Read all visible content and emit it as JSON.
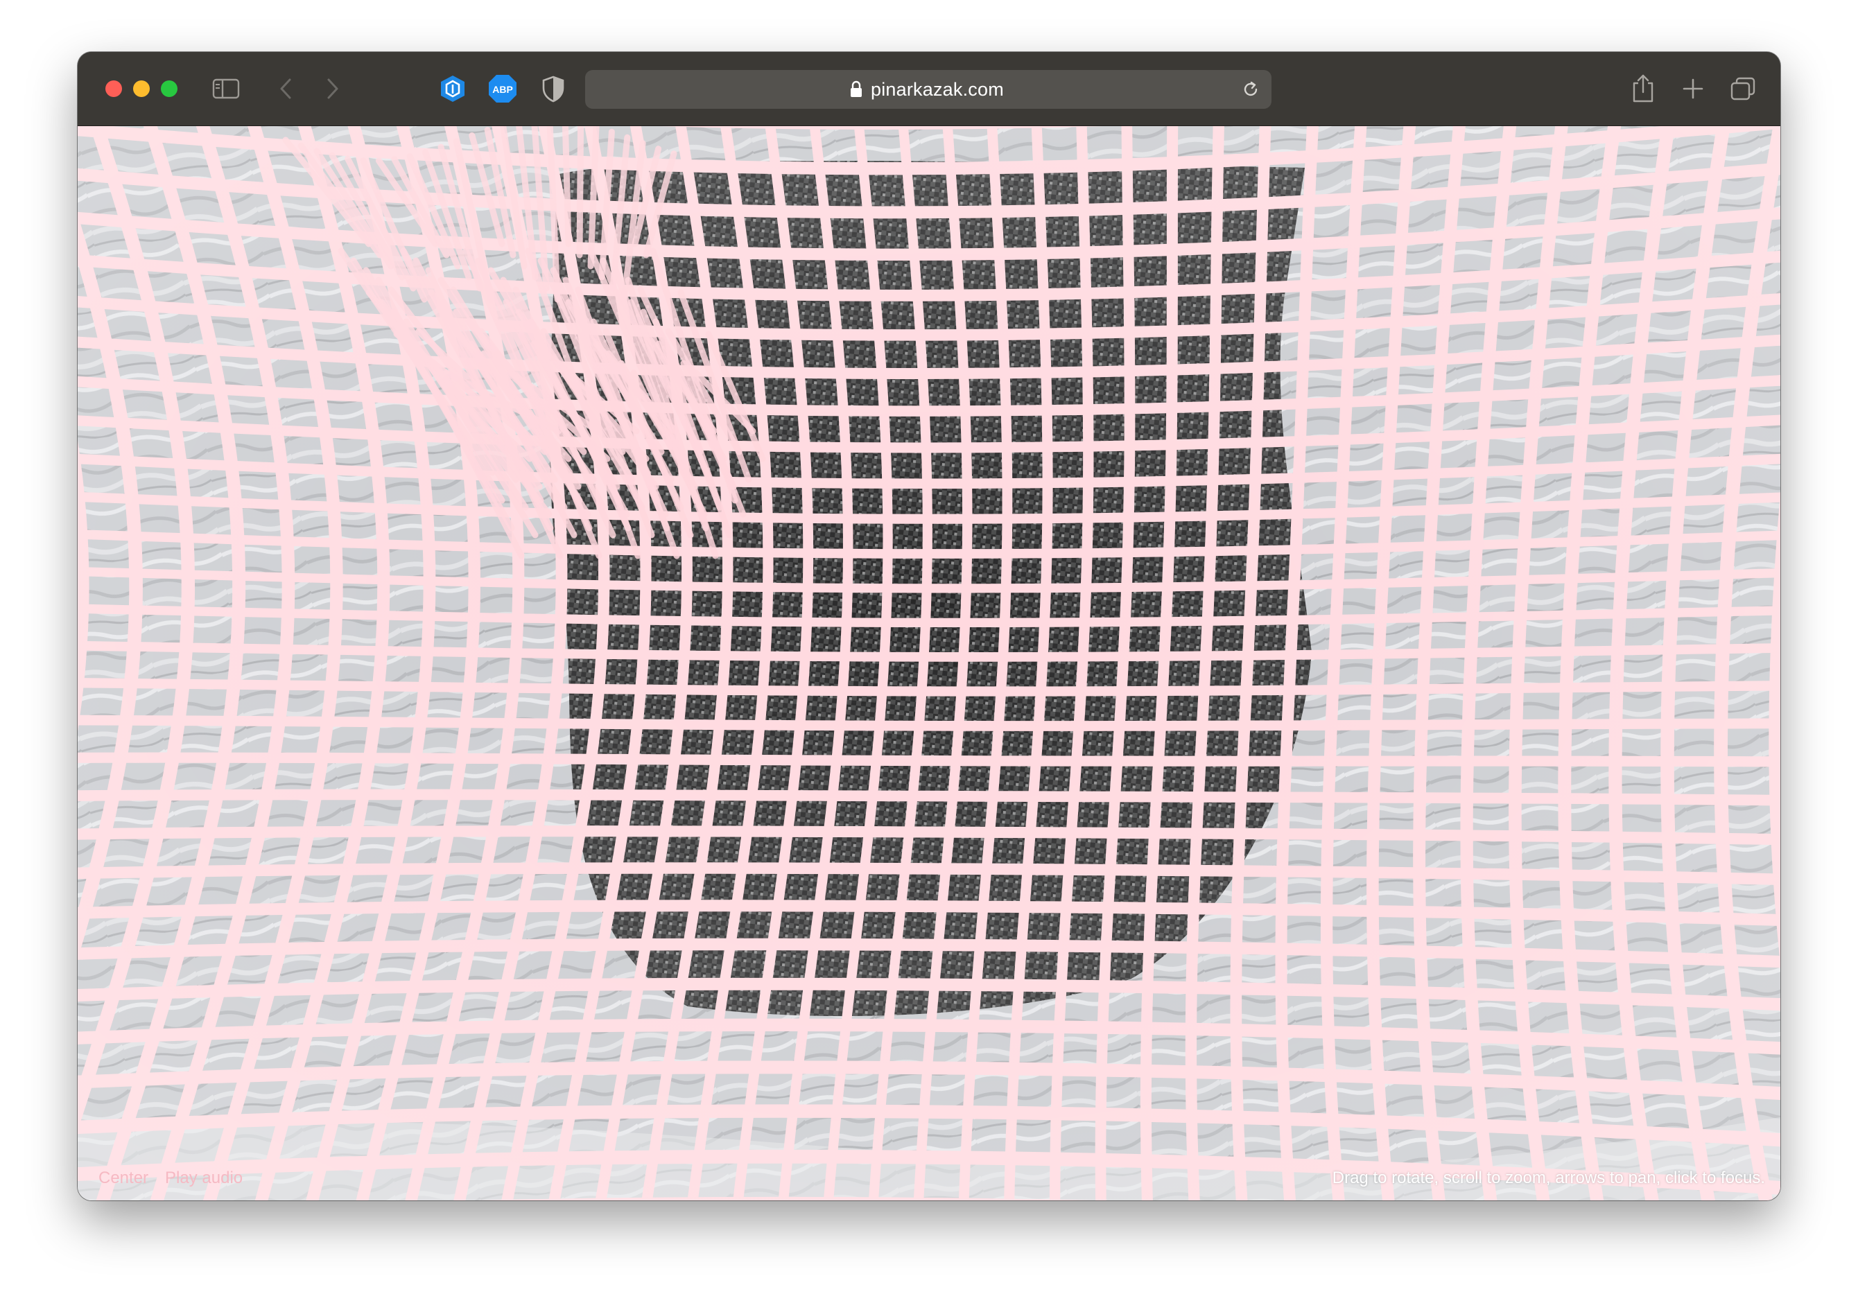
{
  "browser": {
    "url": "pinarkazak.com",
    "extensions": [
      "hexagon-extension-icon",
      "adblock-plus-icon",
      "privacy-shield-icon"
    ],
    "extension_labels": {
      "adblock": "ABP"
    }
  },
  "overlay": {
    "left_links": [
      "Center",
      "Play audio"
    ],
    "hint": "Drag to rotate, scroll to zoom, arrows to pan, click to focus."
  },
  "colors": {
    "mesh": "#ffd9df",
    "background": "#cfd1d5",
    "dark_patch": "#2d2d2d",
    "toolbar": "#3b3935",
    "address_bar": "#54524e"
  }
}
